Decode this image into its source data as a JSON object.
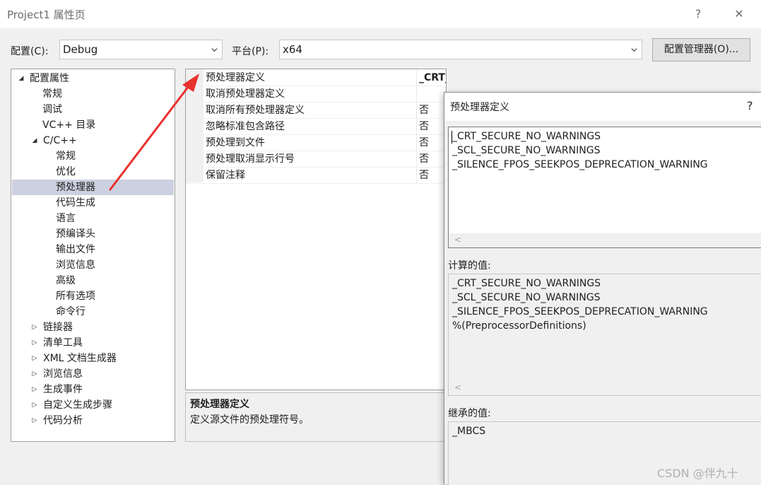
{
  "window": {
    "title": "Project1 属性页",
    "help_glyph": "?",
    "close_glyph": "✕"
  },
  "toolbar": {
    "config_label": "配置(C):",
    "config_value": "Debug",
    "platform_label": "平台(P):",
    "platform_value": "x64",
    "config_manager_label": "配置管理器(O)..."
  },
  "tree": {
    "root": "配置属性",
    "items": [
      "常规",
      "调试",
      "VC++ 目录"
    ],
    "cpp": "C/C++",
    "cpp_children": [
      "常规",
      "优化",
      "预处理器",
      "代码生成",
      "语言",
      "预编译头",
      "输出文件",
      "浏览信息",
      "高级",
      "所有选项",
      "命令行"
    ],
    "selected": "预处理器",
    "collapsed": [
      "链接器",
      "清单工具",
      "XML 文档生成器",
      "浏览信息",
      "生成事件",
      "自定义生成步骤",
      "代码分析"
    ]
  },
  "grid": {
    "rows": [
      {
        "name": "预处理器定义",
        "value": "_CRT_SECURE_NO_WARNINGS;_SCL_SECURE_NO_WARNINGS;_S"
      },
      {
        "name": "取消预处理器定义",
        "value": ""
      },
      {
        "name": "取消所有预处理器定义",
        "value": "否"
      },
      {
        "name": "忽略标准包含路径",
        "value": "否"
      },
      {
        "name": "预处理到文件",
        "value": "否"
      },
      {
        "name": "预处理取消显示行号",
        "value": "否"
      },
      {
        "name": "保留注释",
        "value": "否"
      }
    ]
  },
  "description": {
    "title": "预处理器定义",
    "text": "定义源文件的预处理符号。"
  },
  "dialog": {
    "title": "预处理器定义",
    "help_glyph": "?",
    "edit_lines": [
      "_CRT_SECURE_NO_WARNINGS",
      "_SCL_SECURE_NO_WARNINGS",
      "_SILENCE_FPOS_SEEKPOS_DEPRECATION_WARNING"
    ],
    "computed_label": "计算的值:",
    "computed_lines": [
      "_CRT_SECURE_NO_WARNINGS",
      "_SCL_SECURE_NO_WARNINGS",
      "_SILENCE_FPOS_SEEKPOS_DEPRECATION_WARNING",
      "%(PreprocessorDefinitions)"
    ],
    "inherited_label": "继承的值:",
    "inherited_lines": [
      "_MBCS"
    ],
    "scroll_left_glyph": "<"
  },
  "watermark": "CSDN @伴九十",
  "colors": {
    "annotation_arrow": "#e8322e",
    "selection": "#cdd0e0"
  }
}
